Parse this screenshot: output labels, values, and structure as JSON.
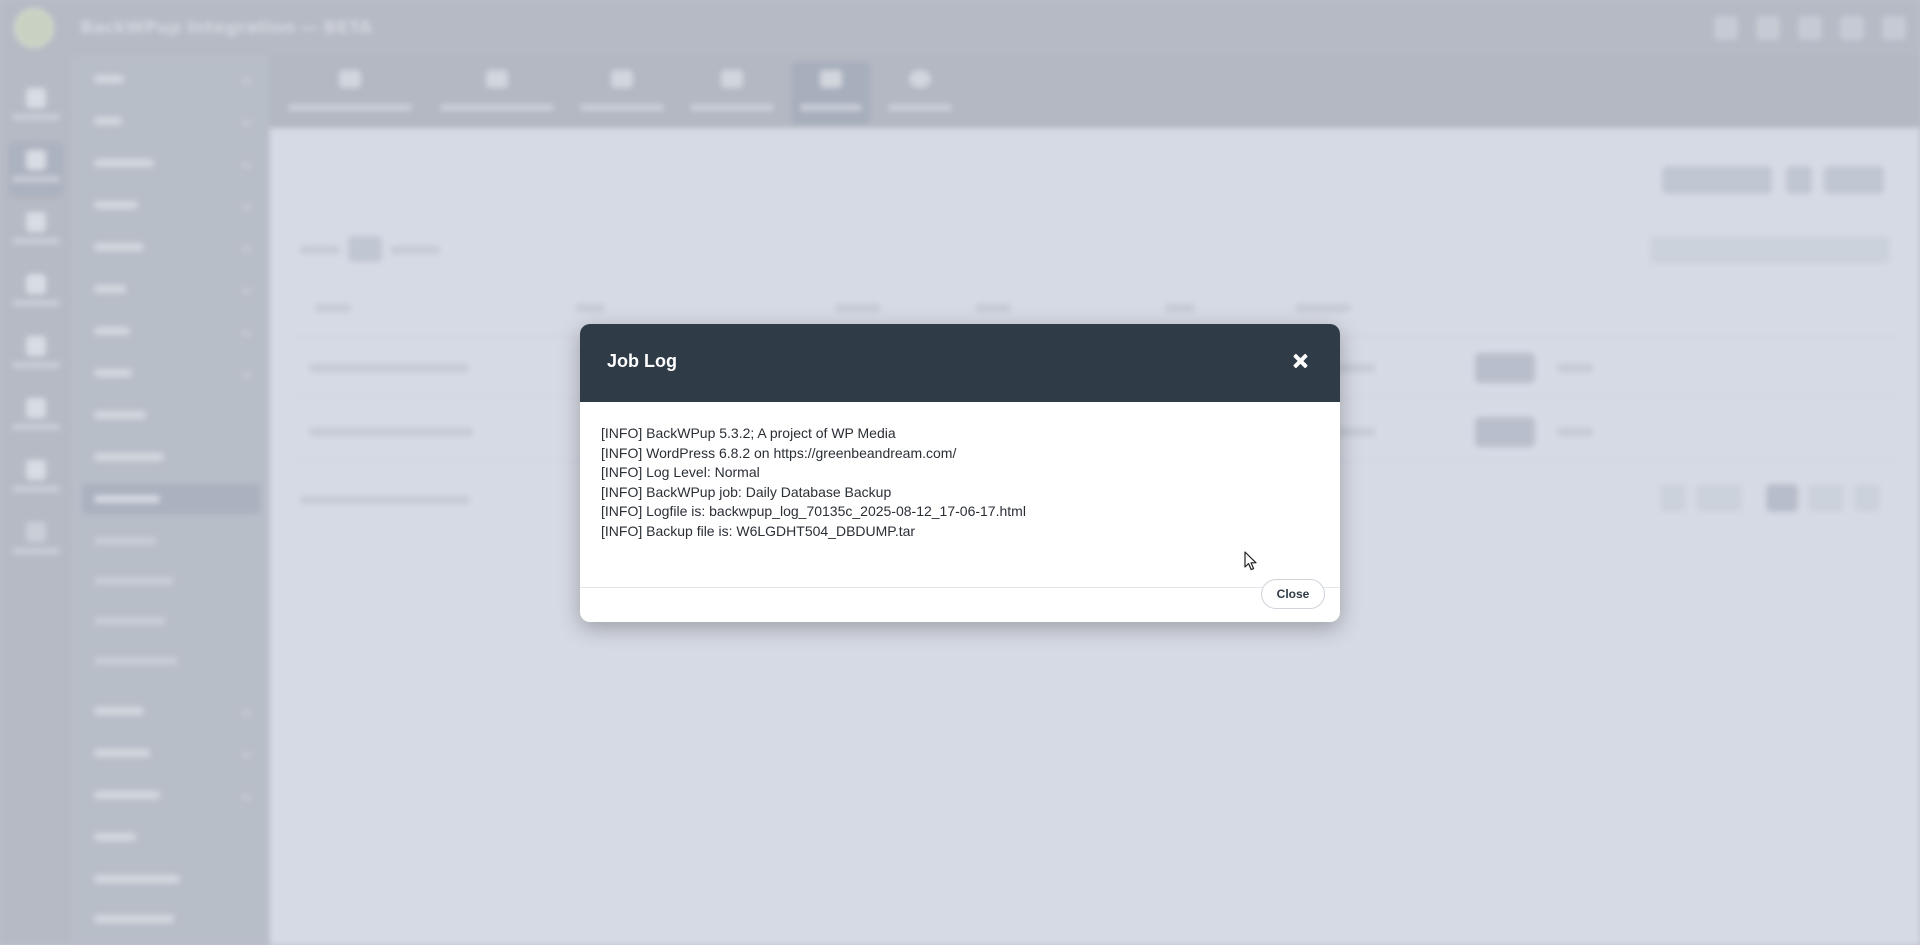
{
  "app": {
    "topbar_title": "BackWPup Integration — BETA"
  },
  "modal": {
    "title": "Job Log",
    "close_label": "Close",
    "log_lines": [
      "[INFO] BackWPup 5.3.2; A project of WP Media",
      "[INFO] WordPress 6.8.2 on https://greenbeandream.com/",
      "[INFO] Log Level: Normal",
      "[INFO] BackWPup job: Daily Database Backup",
      "[INFO] Logfile is: backwpup_log_70135c_2025-08-12_17-06-17.html",
      "[INFO] Backup file is: W6LGDHT504_DBDUMP.tar"
    ]
  },
  "colors": {
    "modal_header": "#2f3b46",
    "modal_background": "#ffffff",
    "page_background": "#e6ebf4"
  },
  "icons": {
    "modal_close": "close-icon",
    "cursor": "mouse-pointer-icon"
  }
}
